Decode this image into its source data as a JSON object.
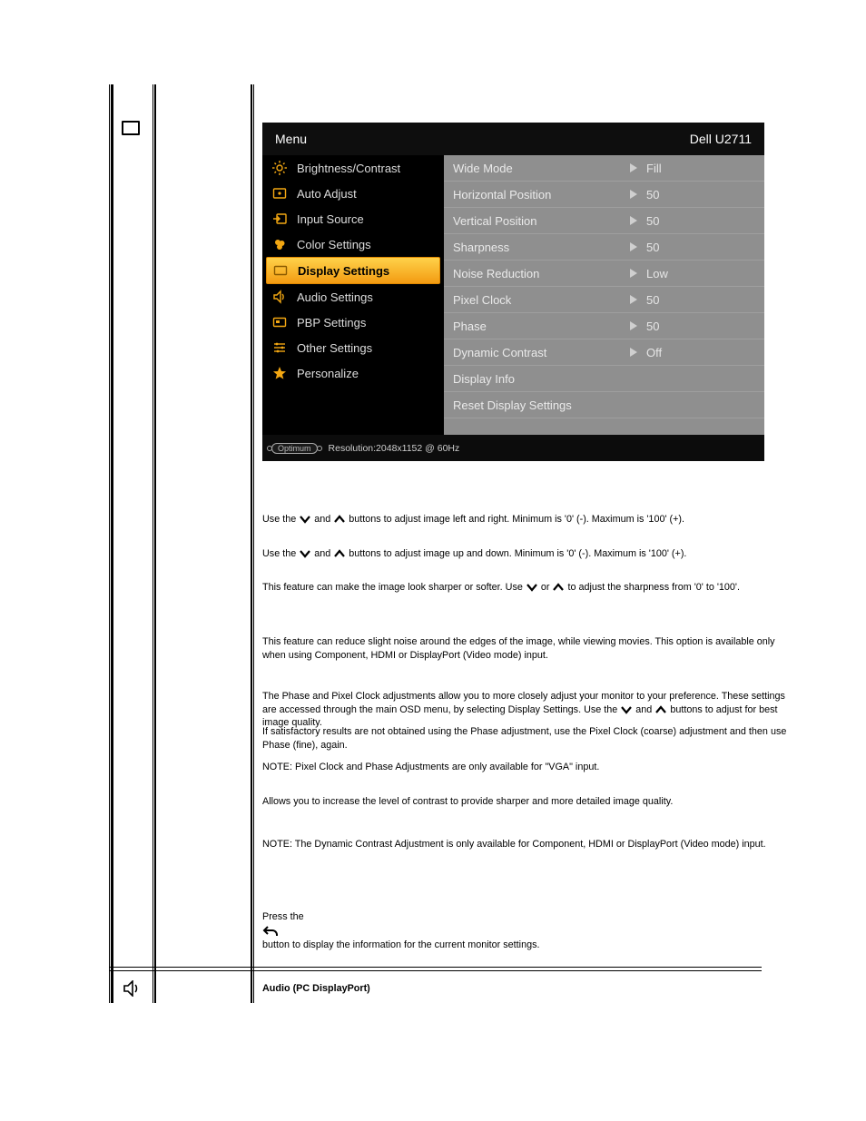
{
  "osd": {
    "title": "Menu",
    "model": "Dell U2711",
    "left_items": [
      {
        "icon": "brightness",
        "label": "Brightness/Contrast",
        "selected": false
      },
      {
        "icon": "auto",
        "label": "Auto Adjust",
        "selected": false
      },
      {
        "icon": "input",
        "label": "Input Source",
        "selected": false
      },
      {
        "icon": "color",
        "label": "Color Settings",
        "selected": false
      },
      {
        "icon": "display",
        "label": "Display Settings",
        "selected": true
      },
      {
        "icon": "audio",
        "label": "Audio Settings",
        "selected": false
      },
      {
        "icon": "pbp",
        "label": "PBP Settings",
        "selected": false
      },
      {
        "icon": "other",
        "label": "Other Settings",
        "selected": false
      },
      {
        "icon": "personalize",
        "label": "Personalize",
        "selected": false
      }
    ],
    "right_items": [
      {
        "label": "Wide Mode",
        "value": "Fill",
        "has_value": true
      },
      {
        "label": "Horizontal Position",
        "value": "50",
        "has_value": true
      },
      {
        "label": "Vertical Position",
        "value": "50",
        "has_value": true
      },
      {
        "label": "Sharpness",
        "value": "50",
        "has_value": true
      },
      {
        "label": "Noise Reduction",
        "value": "Low",
        "has_value": true
      },
      {
        "label": "Pixel Clock",
        "value": "50",
        "has_value": true
      },
      {
        "label": "Phase",
        "value": "50",
        "has_value": true
      },
      {
        "label": "Dynamic Contrast",
        "value": "Off",
        "has_value": true
      },
      {
        "label": "Display Info",
        "value": "",
        "has_value": false
      },
      {
        "label": "Reset Display Settings",
        "value": "",
        "has_value": false
      }
    ],
    "footer": {
      "badge": "Optimum",
      "resolution": "Resolution:2048x1152 @ 60Hz"
    }
  },
  "doc": {
    "p1_a": "Use the ",
    "p1_b": " and ",
    "p1_c": " buttons to adjust image left and right. Minimum is '0' (-). Maximum is '100' (+).",
    "p2_a": "Use the ",
    "p2_b": " and ",
    "p2_c": " buttons to adjust image up and down. Minimum is '0' (-). Maximum is '100' (+).",
    "p3_a": "This feature can make the image look sharper or softer. Use ",
    "p3_b": " or ",
    "p3_c": " to adjust the sharpness from '0' to '100'.",
    "p4": "This feature can reduce slight noise around the edges of the image, while viewing movies. This option is available only when using Component, HDMI or DisplayPort (Video mode) input.",
    "p5_a": "The Phase and Pixel Clock adjustments allow you to more closely adjust your monitor to your preference. These settings are accessed through the main OSD menu, by selecting Display Settings. Use the ",
    "p5_b": " and ",
    "p5_c": " buttons to adjust for best image quality.",
    "p6": "If satisfactory results are not obtained using the Phase adjustment, use the Pixel Clock (coarse) adjustment and then use Phase (fine), again.",
    "p7": "NOTE: Pixel Clock and Phase Adjustments are only available for \"VGA\" input.",
    "p8": "Allows you to increase the level of contrast to provide sharper and more detailed image quality.",
    "p9": "NOTE: The Dynamic Contrast Adjustment is only available for Component, HDMI or DisplayPort (Video mode) input.",
    "p10_a": "Press the ",
    "p10_b": " button to display the information for the current monitor settings.",
    "p11": "Audio (PC DisplayPort)"
  }
}
